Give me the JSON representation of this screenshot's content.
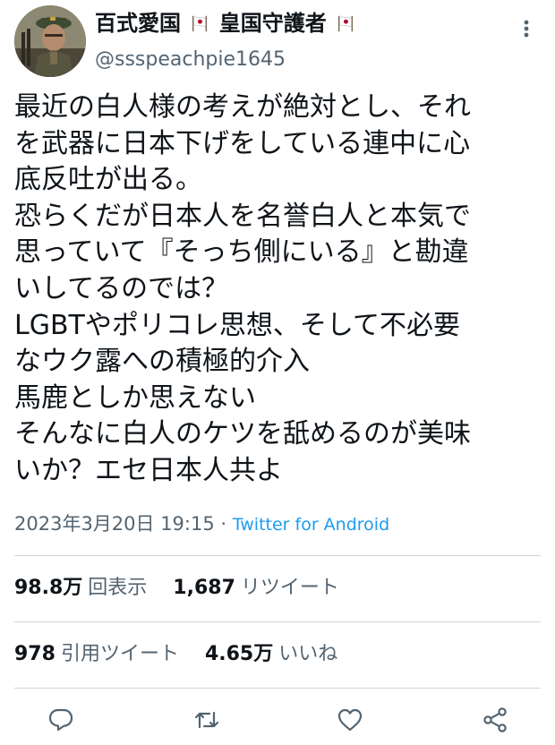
{
  "user": {
    "display_name_a": "百式愛国",
    "display_name_b": "皇国守護者",
    "handle": "@ssspeachpie1645"
  },
  "tweet": {
    "lines": [
      "最近の白人様の考えが絶対とし、それ",
      "を武器に日本下げをしている連中に心",
      "底反吐が出る。",
      "恐らくだが日本人を名誉白人と本気で",
      "思っていて『そっち側にいる』と勘違",
      "いしてるのでは？",
      "LGBTやポリコレ思想、そして不必要",
      "なウク露への積極的介入",
      "馬鹿としか思えない",
      "そんなに白人のケツを舐めるのが美味",
      "いか？エセ日本人共よ"
    ],
    "timestamp": "2023年3月20日 19:15",
    "separator": "·",
    "source": "Twitter for Android"
  },
  "stats": {
    "views_count": "98.8万",
    "views_label": "回表示",
    "retweets_count": "1,687",
    "retweets_label": "リツイート",
    "quotes_count": "978",
    "quotes_label": "引用ツイート",
    "likes_count": "4.65万",
    "likes_label": "いいね"
  },
  "icons": {
    "flag": "japan-flag-icon",
    "more": "more-vertical-icon",
    "reply": "reply-icon",
    "retweet": "retweet-icon",
    "like": "heart-icon",
    "share": "share-icon"
  },
  "colors": {
    "text": "#0f1419",
    "secondary": "#536471",
    "link": "#1d9bf0",
    "divider": "#cfd9de",
    "flag_red": "#bc002d"
  }
}
